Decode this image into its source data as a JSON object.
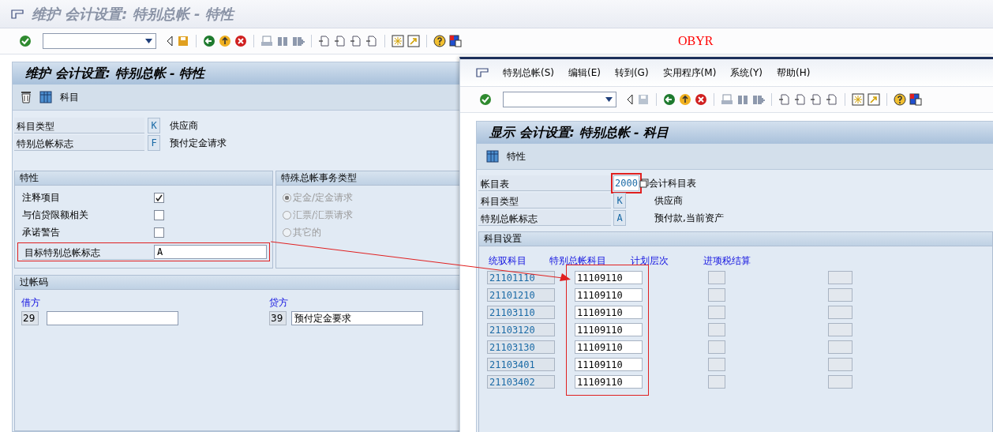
{
  "back_window": {
    "title": "维护 会计设置: 特别总帐 - 特性",
    "transaction_code": "OBYR",
    "screen_title": "维护 会计设置: 特别总帐 - 特性",
    "app_button": "科目",
    "header_fields": [
      {
        "label": "科目类型",
        "value": "K",
        "description": "供应商"
      },
      {
        "label": "特别总帐标志",
        "value": "F",
        "description": "预付定金请求"
      }
    ],
    "properties": {
      "title": "特性",
      "checkboxes": [
        {
          "label": "注释项目",
          "checked": true
        },
        {
          "label": "与信贷限额相关",
          "checked": false
        },
        {
          "label": "承诺警告",
          "checked": false
        }
      ],
      "target": {
        "label": "目标特别总帐标志",
        "value": "A"
      }
    },
    "transaction_types": {
      "title": "特殊总帐事务类型",
      "options": [
        {
          "label": "定金/定金请求",
          "selected": true,
          "disabled": true
        },
        {
          "label": "汇票/汇票请求",
          "selected": false,
          "disabled": true
        },
        {
          "label": "其它的",
          "selected": false,
          "disabled": true
        }
      ]
    },
    "posting_keys": {
      "title": "过帐码",
      "debit": {
        "label": "借方",
        "key": "29"
      },
      "credit": {
        "label": "贷方",
        "key": "39",
        "description": "预付定金要求"
      }
    }
  },
  "front_window": {
    "menu": [
      "特别总帐(S)",
      "编辑(E)",
      "转到(G)",
      "实用程序(M)",
      "系统(Y)",
      "帮助(H)"
    ],
    "screen_title": "显示 会计设置: 特别总帐 - 科目",
    "app_button": "特性",
    "header_fields": [
      {
        "label": "帐目表",
        "value": "2000",
        "description": "会计科目表",
        "focused": true
      },
      {
        "label": "科目类型",
        "value": "K",
        "description": "供应商",
        "focused": false
      },
      {
        "label": "特别总帐标志",
        "value": "A",
        "description": "预付款,当前资产",
        "focused": false
      }
    ],
    "accounts": {
      "title": "科目设置",
      "columns": [
        "统驭科目",
        "特别总帐科目",
        "计划层次",
        "进项税结算"
      ],
      "rows": [
        {
          "reconciliation": "21101110",
          "special": "11109110"
        },
        {
          "reconciliation": "21101210",
          "special": "11109110"
        },
        {
          "reconciliation": "21103110",
          "special": "11109110"
        },
        {
          "reconciliation": "21103120",
          "special": "11109110"
        },
        {
          "reconciliation": "21103130",
          "special": "11109110"
        },
        {
          "reconciliation": "21103401",
          "special": "11109110"
        },
        {
          "reconciliation": "21103402",
          "special": "11109110"
        }
      ]
    }
  }
}
